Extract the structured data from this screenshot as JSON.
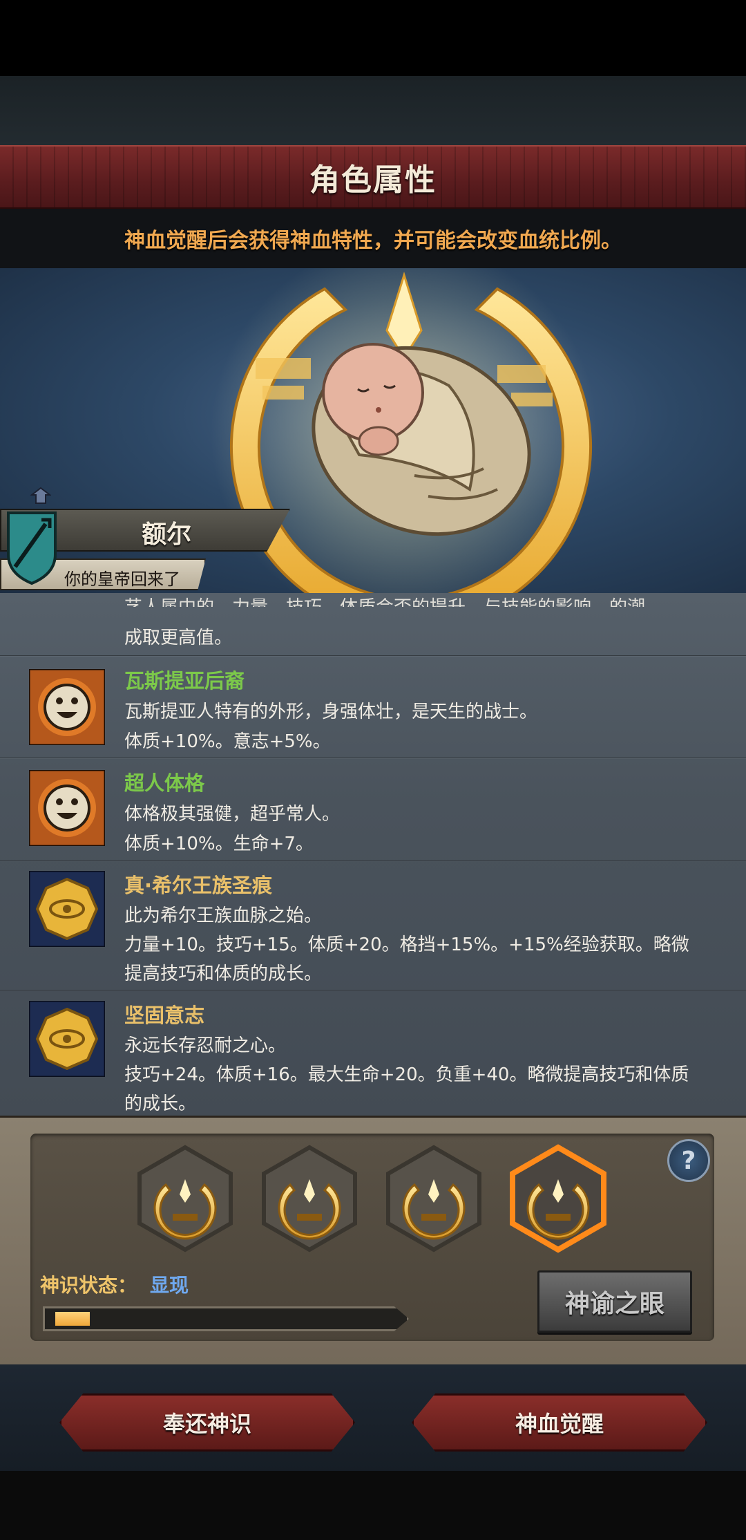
{
  "header": {
    "title": "角色属性",
    "notice": "神血觉醒后会获得神血特性，并可能会改变血统比例。"
  },
  "character": {
    "name": "额尔",
    "subtitle": "你的皇帝回来了"
  },
  "traits_partial": {
    "cut_text": "艺人属中的，力量、技巧、体质会否的提升，与技能的影响…的潮",
    "last_line": "成取更高值。"
  },
  "traits": [
    {
      "icon": "smile-face-icon",
      "name": "瓦斯提亚后裔",
      "name_color": "#7cc94a",
      "lines": [
        "瓦斯提亚人特有的外形，身强体壮，是天生的战士。",
        "体质+10%。意志+5%。"
      ]
    },
    {
      "icon": "smile-face-icon",
      "name": "超人体格",
      "name_color": "#7cc94a",
      "lines": [
        "体格极其强健，超乎常人。",
        "体质+10%。生命+7。"
      ]
    },
    {
      "icon": "gold-seal-icon",
      "name": "真·希尔王族圣痕",
      "name_color": "#e9c06a",
      "lines": [
        "此为希尔王族血脉之始。",
        "力量+10。技巧+15。体质+20。格挡+15%。+15%经验获取。略微",
        "提高技巧和体质的成长。"
      ]
    },
    {
      "icon": "gold-seal-icon",
      "name": "坚固意志",
      "name_color": "#e9c06a",
      "lines": [
        "永远长存忍耐之心。",
        "技巧+24。体质+16。最大生命+20。负重+40。略微提高技巧和体质",
        "的成长。"
      ]
    }
  ],
  "divine_sense": {
    "slots": [
      "divine-crescent-icon",
      "divine-crescent-icon",
      "divine-crescent-icon",
      "divine-crescent-icon"
    ],
    "selected_slot": 4,
    "status_label": "神识状态：",
    "status_value": "显现",
    "progress": 0.1,
    "oracle_button": "神谕之眼",
    "help": "?"
  },
  "actions": {
    "return_button": "奉还神识",
    "awaken_button": "神血觉醒"
  },
  "colors": {
    "banner_red": "#5a1c1e",
    "notice_orange": "#f0a850",
    "trait_green": "#7cc94a",
    "trait_gold": "#e9c06a",
    "status_blue": "#6fa8ee",
    "progress_gold": "#f0a83a"
  }
}
